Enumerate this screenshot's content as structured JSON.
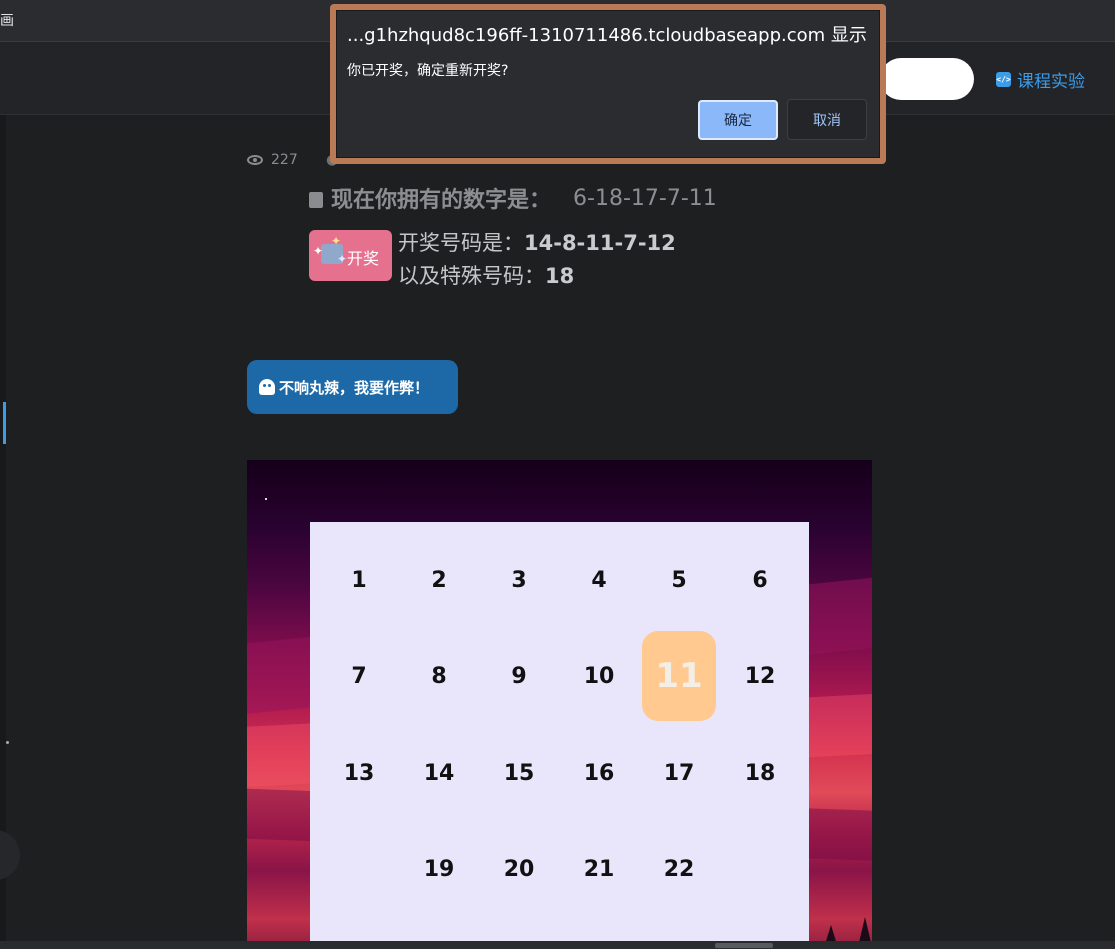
{
  "topbar": {
    "partial_char": "画"
  },
  "navbar": {
    "course_link": "课程实验"
  },
  "meta": {
    "views": "227"
  },
  "owned": {
    "label": "现在你拥有的数字是：",
    "numbers": "6-18-17-7-11"
  },
  "draw_button": {
    "label": "开奖"
  },
  "winning": {
    "line1_prefix": "开奖号码是：",
    "line1_value": "14-8-11-7-12",
    "line2_prefix": "以及特殊号码：",
    "line2_value": "18"
  },
  "cheat_button": {
    "label": "不响丸辣，我要作弊！"
  },
  "board": {
    "numbers": [
      "1",
      "2",
      "3",
      "4",
      "5",
      "6",
      "7",
      "8",
      "9",
      "10",
      "11",
      "12",
      "13",
      "14",
      "15",
      "16",
      "17",
      "18",
      "19",
      "20",
      "21",
      "22"
    ],
    "highlighted": "11"
  },
  "dialog": {
    "title": "...g1hzhqud8c196ff-1310711486.tcloudbaseapp.com 显示",
    "message": "你已开奖，确定重新开奖?",
    "ok_label": "确定",
    "cancel_label": "取消"
  },
  "colors": {
    "accent_blue": "#3b9ce8",
    "cheat_button": "#1d69a8",
    "draw_button": "#e6718f",
    "highlight_cell": "#ffc98f",
    "board_bg": "#e9e6fc",
    "dialog_border": "#b97a55"
  },
  "icons": {
    "meta": "eye-icon",
    "owned": "document-icon",
    "course": "code-icon",
    "cheat": "ghost-icon",
    "draw": "gift-icon"
  }
}
